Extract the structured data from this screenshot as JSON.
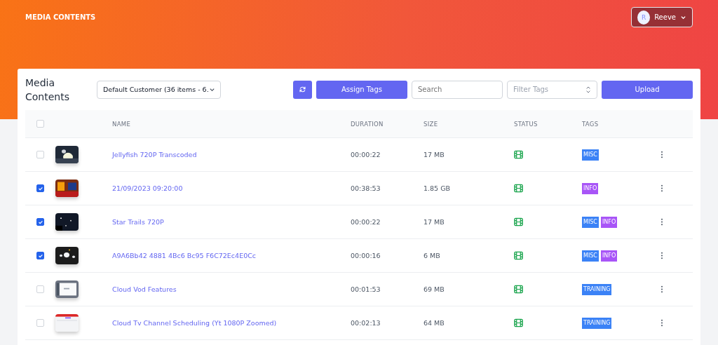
{
  "header": {
    "title": "MEDIA CONTENTS",
    "user": {
      "initial": "R",
      "name": "Reeve"
    }
  },
  "toolbar": {
    "title": "Media\nContents",
    "customer": "Default Customer (36 items - 6.",
    "assign_label": "Assign Tags",
    "search_placeholder": "Search",
    "filter_placeholder": "Filter Tags",
    "upload_label": "Upload"
  },
  "table": {
    "select_all": false,
    "columns": [
      "NAME",
      "DURATION",
      "SIZE",
      "STATUS",
      "TAGS"
    ],
    "rows": [
      {
        "checked": false,
        "name": "Jellyfish 720P Transcoded",
        "duration": "00:00:22",
        "size": "17 MB",
        "tags": [
          {
            "label": "MISC",
            "color": "#3b82f6"
          }
        ]
      },
      {
        "checked": true,
        "name": "21/09/2023 09:20:00",
        "duration": "00:38:53",
        "size": "1.85 GB",
        "tags": [
          {
            "label": "INFO",
            "color": "#a855f7"
          }
        ]
      },
      {
        "checked": true,
        "name": "Star Trails 720P",
        "duration": "00:00:22",
        "size": "17 MB",
        "tags": [
          {
            "label": "MISC",
            "color": "#3b82f6"
          },
          {
            "label": "INFO",
            "color": "#a855f7"
          }
        ]
      },
      {
        "checked": true,
        "name": "A9A6Bb42 4881 4Bc6 Bc95 F6C72Ec4E0Cc",
        "duration": "00:00:16",
        "size": "6 MB",
        "tags": [
          {
            "label": "MISC",
            "color": "#3b82f6"
          },
          {
            "label": "INFO",
            "color": "#a855f7"
          }
        ]
      },
      {
        "checked": false,
        "name": "Cloud Vod Features",
        "duration": "00:01:53",
        "size": "69 MB",
        "tags": [
          {
            "label": "TRAINING",
            "color": "#3b82f6"
          }
        ]
      },
      {
        "checked": false,
        "name": "Cloud Tv Channel Scheduling (Yt 1080P Zoomed)",
        "duration": "00:02:13",
        "size": "64 MB",
        "tags": [
          {
            "label": "TRAINING",
            "color": "#3b82f6"
          }
        ]
      }
    ]
  }
}
